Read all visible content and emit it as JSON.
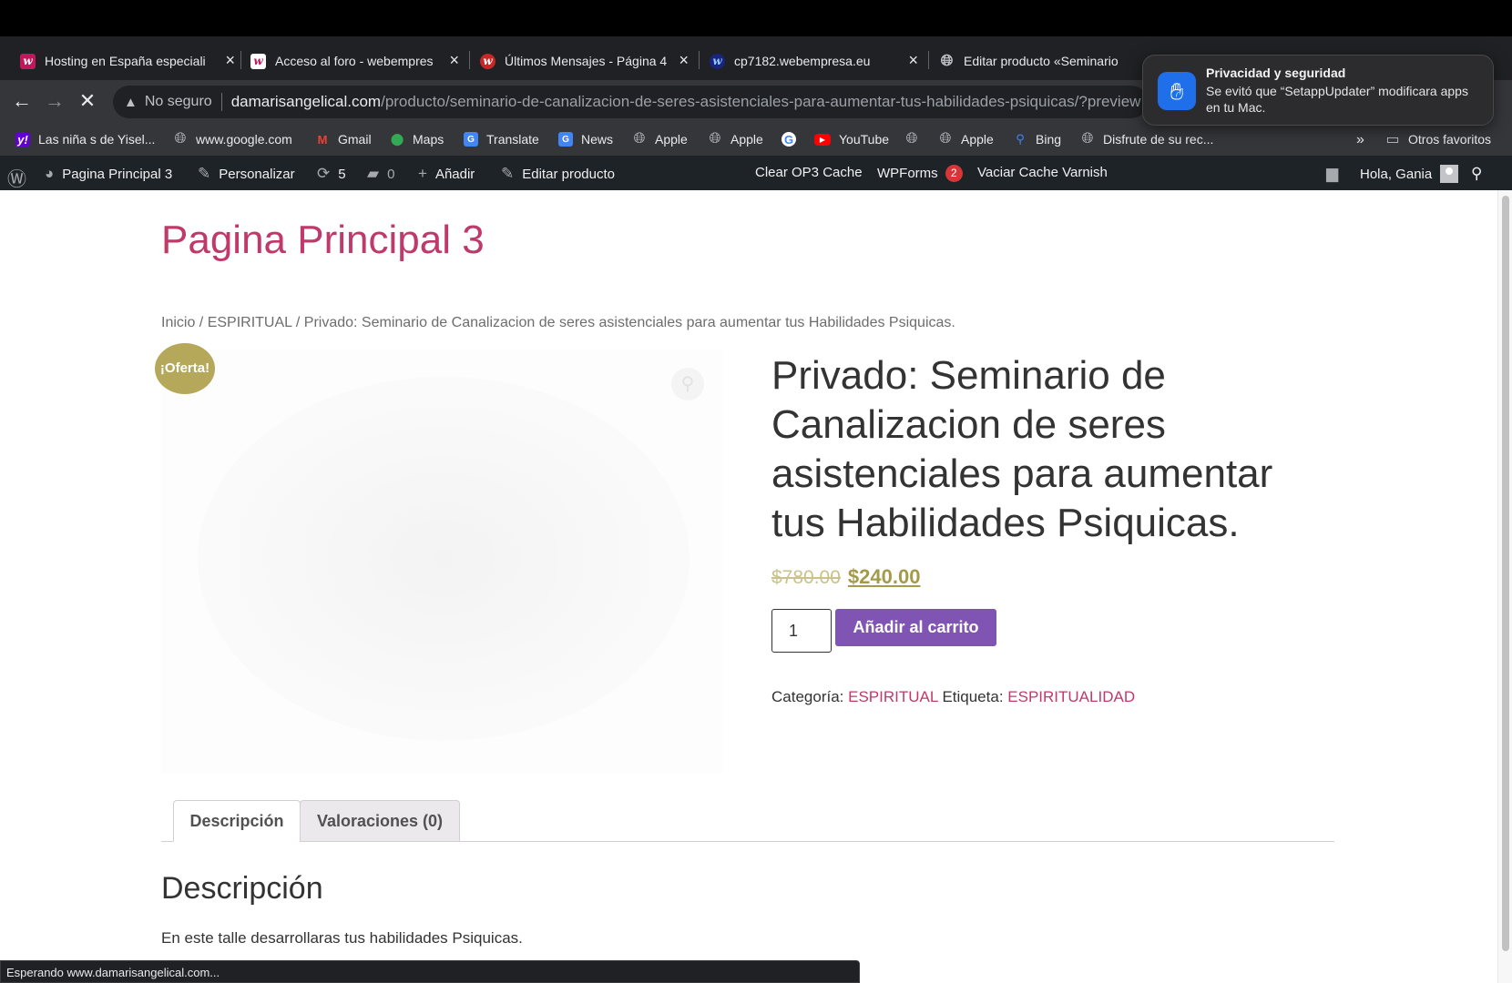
{
  "browser": {
    "tabs": [
      {
        "title": "Hosting en España especiali",
        "favicon": "webempresa-icon"
      },
      {
        "title": "Acceso al foro - webempres",
        "favicon": "webempresa-icon"
      },
      {
        "title": "Últimos Mensajes - Página 4",
        "favicon": "webempresa-icon"
      },
      {
        "title": "cp7182.webempresa.eu",
        "favicon": "webempresa-icon"
      },
      {
        "title": "Editar producto «Seminario",
        "favicon": "globe-icon"
      }
    ],
    "address": {
      "security": "No seguro",
      "host": "damarisangelical.com",
      "path": "/producto/seminario-de-canalizacion-de-seres-asistenciales-para-aumentar-tus-habilidades-psiquicas/?preview"
    },
    "bookmarks": [
      "Las niña s de Yisel...",
      "www.google.com",
      "Gmail",
      "Maps",
      "Translate",
      "News",
      "Apple",
      "Apple",
      "",
      "YouTube",
      "",
      "Apple",
      "Bing",
      "Disfrute de su rec..."
    ],
    "bookmarks_overflow": "»",
    "other_bookmarks": "Otros favoritos",
    "status": "Esperando www.damarisangelical.com..."
  },
  "notification": {
    "title": "Privacidad y seguridad",
    "body": "Se evitó que “SetappUpdater” modificara apps en tu Mac."
  },
  "adminbar": {
    "site": "Pagina Principal 3",
    "customize": "Personalizar",
    "updates": "5",
    "comments": "0",
    "add_new": "Añadir",
    "edit": "Editar producto",
    "cache": "Clear OP3 Cache",
    "wpforms": "WPForms",
    "wpforms_count": "2",
    "varnish": "Vaciar Cache Varnish",
    "greeting": "Hola, Gania"
  },
  "page": {
    "site_title": "Pagina Principal 3",
    "breadcrumb": "Inicio / ESPIRITUAL / Privado: Seminario de Canalizacion de seres asistenciales para aumentar tus Habilidades Psiquicas.",
    "sale_badge": "¡Oferta!",
    "product_title": "Privado: Seminario de Canalizacion de seres asistenciales para aumentar tus Habilidades Psiquicas.",
    "price_old": "$780.00",
    "price_new": "$240.00",
    "quantity": "1",
    "add_to_cart": "Añadir al carrito",
    "category_label": "Categoría:",
    "category": "ESPIRITUAL",
    "tag_label": "Etiqueta:",
    "tag": "ESPIRITUALIDAD",
    "tab_description": "Descripción",
    "tab_reviews": "Valoraciones (0)",
    "description_heading": "Descripción",
    "description_text": "En este talle desarrollaras tus habilidades Psiquicas."
  },
  "colors": {
    "accent_pink": "#c0396b",
    "sale_olive": "#b5a85b",
    "button_purple": "#7f54b3",
    "adminbar_bg": "#1d2327"
  }
}
